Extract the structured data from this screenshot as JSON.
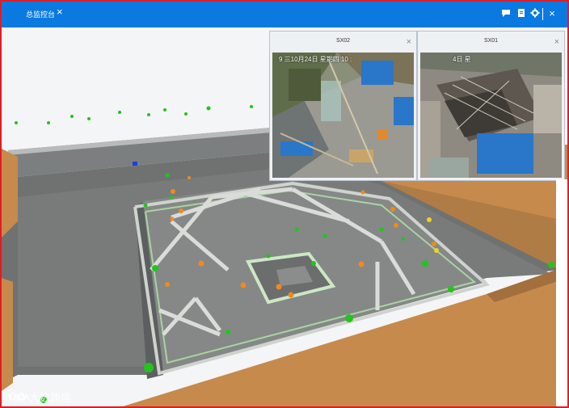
{
  "window": {
    "tab_label": "总监控台",
    "tab_close": "×",
    "toolbar_icons": [
      "chat-icon",
      "document-icon",
      "gear-icon",
      "close-icon"
    ],
    "close_glyph": "×"
  },
  "cameras": [
    {
      "id": "cam-sx02",
      "title": "SX02",
      "timestamp": "9 三10月24日 星期四 10 :",
      "close_glyph": "×"
    },
    {
      "id": "cam-sx01",
      "title": "SX01",
      "timestamp": "4日 星",
      "close_glyph": "×"
    }
  ],
  "watermark": "大数跨境",
  "colors": {
    "accent": "#0a7ae0",
    "frame_border": "#e11d24",
    "marker_green": "#22c51a",
    "marker_orange": "#f08a1c",
    "marker_yellow": "#f2d21a",
    "marker_blue": "#1f3fe0"
  }
}
